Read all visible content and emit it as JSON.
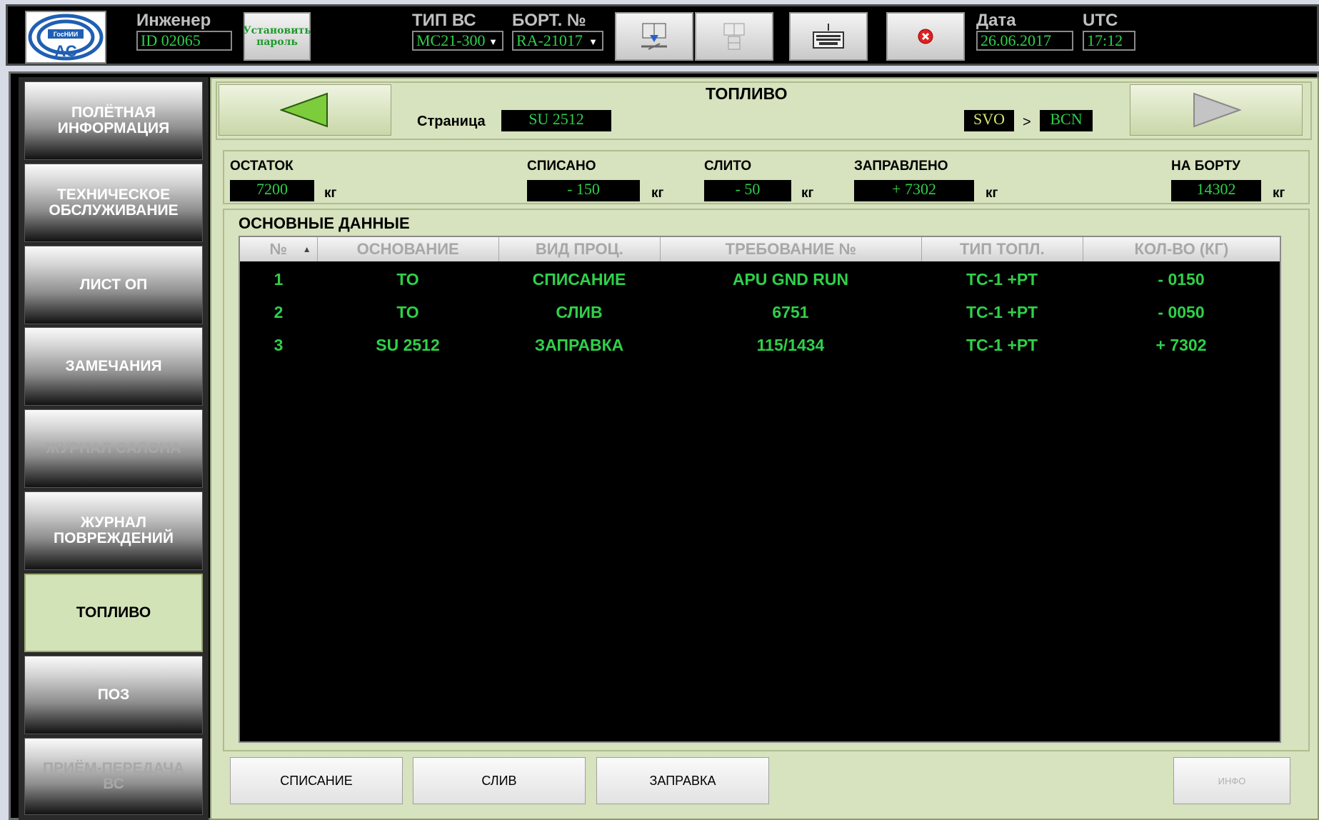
{
  "header": {
    "engineer_label": "Инженер",
    "engineer_id": "ID 02065",
    "set_password_label": "Установить пароль",
    "ac_type_label": "ТИП ВС",
    "ac_type_value": "MC21-300",
    "tail_label": "БОРТ. №",
    "tail_value": "RA-21017",
    "date_label": "Дата",
    "date_value": "26.06.2017",
    "utc_label": "UTC",
    "utc_value": "17:12",
    "icons": [
      "manual-download-icon",
      "manual-upload-icon",
      "keyboard-icon",
      "close-icon"
    ],
    "logo_text": "ГосНИИ АС"
  },
  "sidebar": {
    "items": [
      {
        "label": "ПОЛЁТНАЯ\nИНФОРМАЦИЯ",
        "state": "normal"
      },
      {
        "label": "ТЕХНИЧЕСКОЕ\nОБСЛУЖИВАНИЕ",
        "state": "normal"
      },
      {
        "label": "ЛИСТ ОП",
        "state": "normal"
      },
      {
        "label": "ЗАМЕЧАНИЯ",
        "state": "normal"
      },
      {
        "label": "ЖУРНАЛ САЛОНА",
        "state": "disabled"
      },
      {
        "label": "ЖУРНАЛ\nПОВРЕЖДЕНИЙ",
        "state": "normal"
      },
      {
        "label": "ТОПЛИВО",
        "state": "active"
      },
      {
        "label": "ПОЗ",
        "state": "normal"
      },
      {
        "label": "ПРИЁМ-ПЕРЕДАЧА\nВС",
        "state": "disabled"
      }
    ]
  },
  "page": {
    "title": "ТОПЛИВО",
    "page_label": "Страница",
    "page_value": "SU 2512",
    "route_from": "SVO",
    "route_sep": ">",
    "route_to": "BCN"
  },
  "summary": {
    "remaining": {
      "label": "ОСТАТОК",
      "value": "7200",
      "unit": "кг"
    },
    "written_off": {
      "label": "СПИСАНО",
      "value": "- 150",
      "unit": "кг"
    },
    "drained": {
      "label": "СЛИТО",
      "value": "- 50",
      "unit": "кг"
    },
    "refueled": {
      "label": "ЗАПРАВЛЕНО",
      "value": "+ 7302",
      "unit": "кг"
    },
    "on_board": {
      "label": "НА БОРТУ",
      "value": "14302",
      "unit": "кг"
    }
  },
  "table": {
    "section_title": "ОСНОВНЫЕ ДАННЫЕ",
    "columns": [
      "№",
      "ОСНОВАНИЕ",
      "ВИД ПРОЦ.",
      "ТРЕБОВАНИЕ №",
      "ТИП ТОПЛ.",
      "КОЛ-ВО (КГ)"
    ],
    "sort_indicator": "▲",
    "rows": [
      [
        "1",
        "ТО",
        "СПИСАНИЕ",
        "APU GND RUN",
        "ТС-1 +РТ",
        "- 0150"
      ],
      [
        "2",
        "ТО",
        "СЛИВ",
        "6751",
        "ТС-1 +РТ",
        "- 0050"
      ],
      [
        "3",
        "SU 2512",
        "ЗАПРАВКА",
        "115/1434",
        "ТС-1 +РТ",
        "+ 7302"
      ]
    ]
  },
  "actions": {
    "write_off": "СПИСАНИЕ",
    "drain": "СЛИВ",
    "refuel": "ЗАПРАВКА",
    "info": "ИНФО"
  },
  "colors": {
    "value_green": "#2fd04a",
    "panel_bg": "#d7e2be",
    "active_nav": "#d3e3b8",
    "arrow_green": "#7ccc3c"
  }
}
